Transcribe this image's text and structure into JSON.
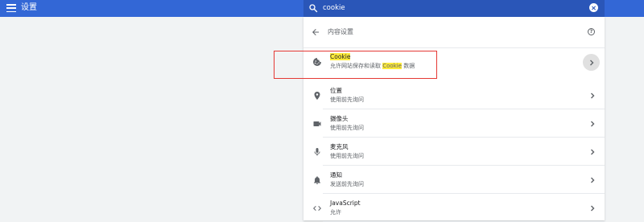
{
  "topbar": {
    "title": "设置",
    "menu_icon": "menu-icon"
  },
  "search": {
    "value": "cookie",
    "icon": "search-icon",
    "clear_icon": "clear-icon"
  },
  "card": {
    "header_title": "内容设置",
    "back_icon": "arrow-back-icon",
    "help_icon": "help-icon",
    "help_glyph": "?"
  },
  "rows": [
    {
      "label": "Cookie",
      "sub_before": "允许网站保存和读取 ",
      "sub_highlight": "Cookie",
      "sub_after": " 数据",
      "icon": "cookie-icon",
      "highlighted": true
    },
    {
      "label": "位置",
      "sub": "使用前先询问",
      "icon": "location-pin-icon"
    },
    {
      "label": "摄像头",
      "sub": "使用前先询问",
      "icon": "camera-icon"
    },
    {
      "label": "麦克风",
      "sub": "使用前先询问",
      "icon": "microphone-icon"
    },
    {
      "label": "通知",
      "sub": "发送前先询问",
      "icon": "bell-icon"
    },
    {
      "label": "JavaScript",
      "sub": "允许",
      "icon": "code-icon"
    }
  ],
  "colors": {
    "topbar": "#3367d6",
    "search_bg": "#2a56b8",
    "page_bg": "#f1f3f4",
    "highlight": "#ffeb3b",
    "annotation_box": "#e53935"
  }
}
